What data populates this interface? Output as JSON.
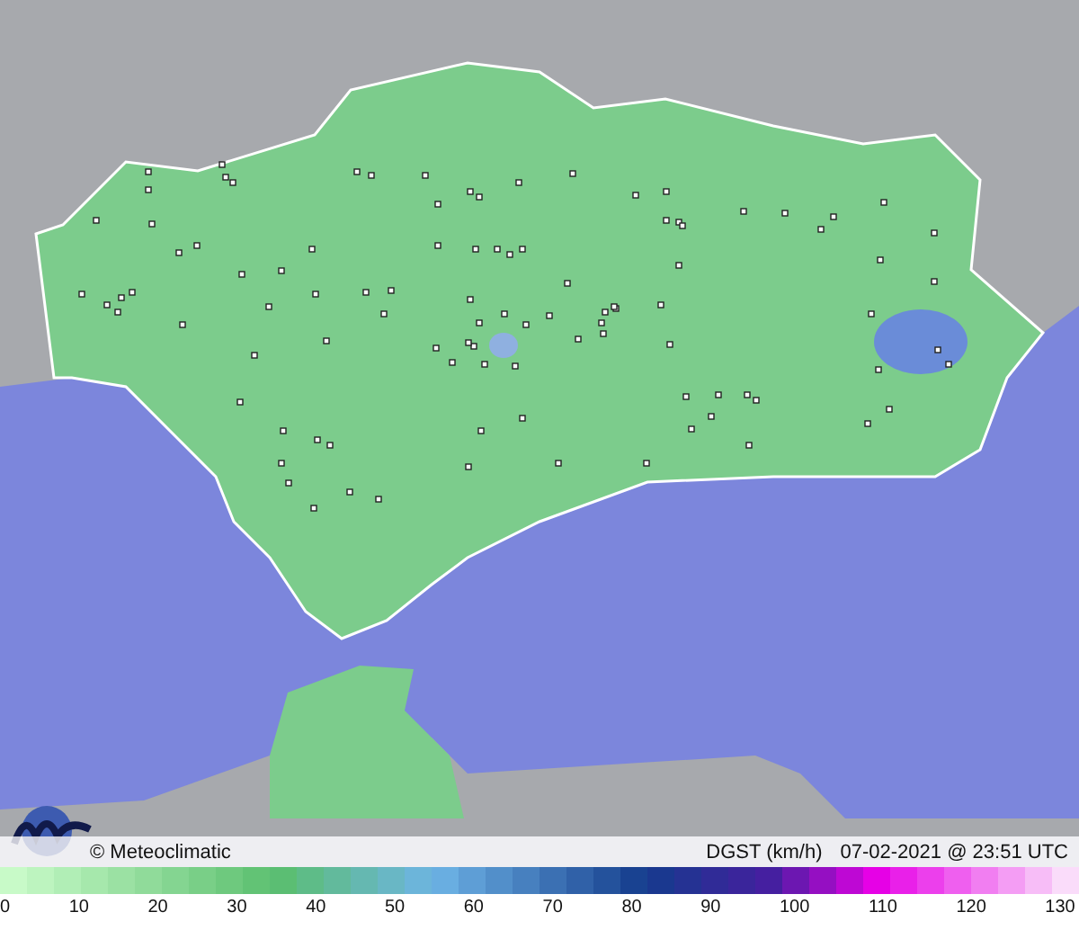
{
  "map": {
    "credit": "© Meteoclimatic",
    "variable": "DGST (km/h)",
    "timestamp": "07-02-2021 @ 23:51 UTC"
  },
  "scale": {
    "labels": [
      "0",
      "10",
      "20",
      "30",
      "40",
      "50",
      "60",
      "70",
      "80",
      "90",
      "100",
      "110",
      "120",
      "130"
    ]
  }
}
